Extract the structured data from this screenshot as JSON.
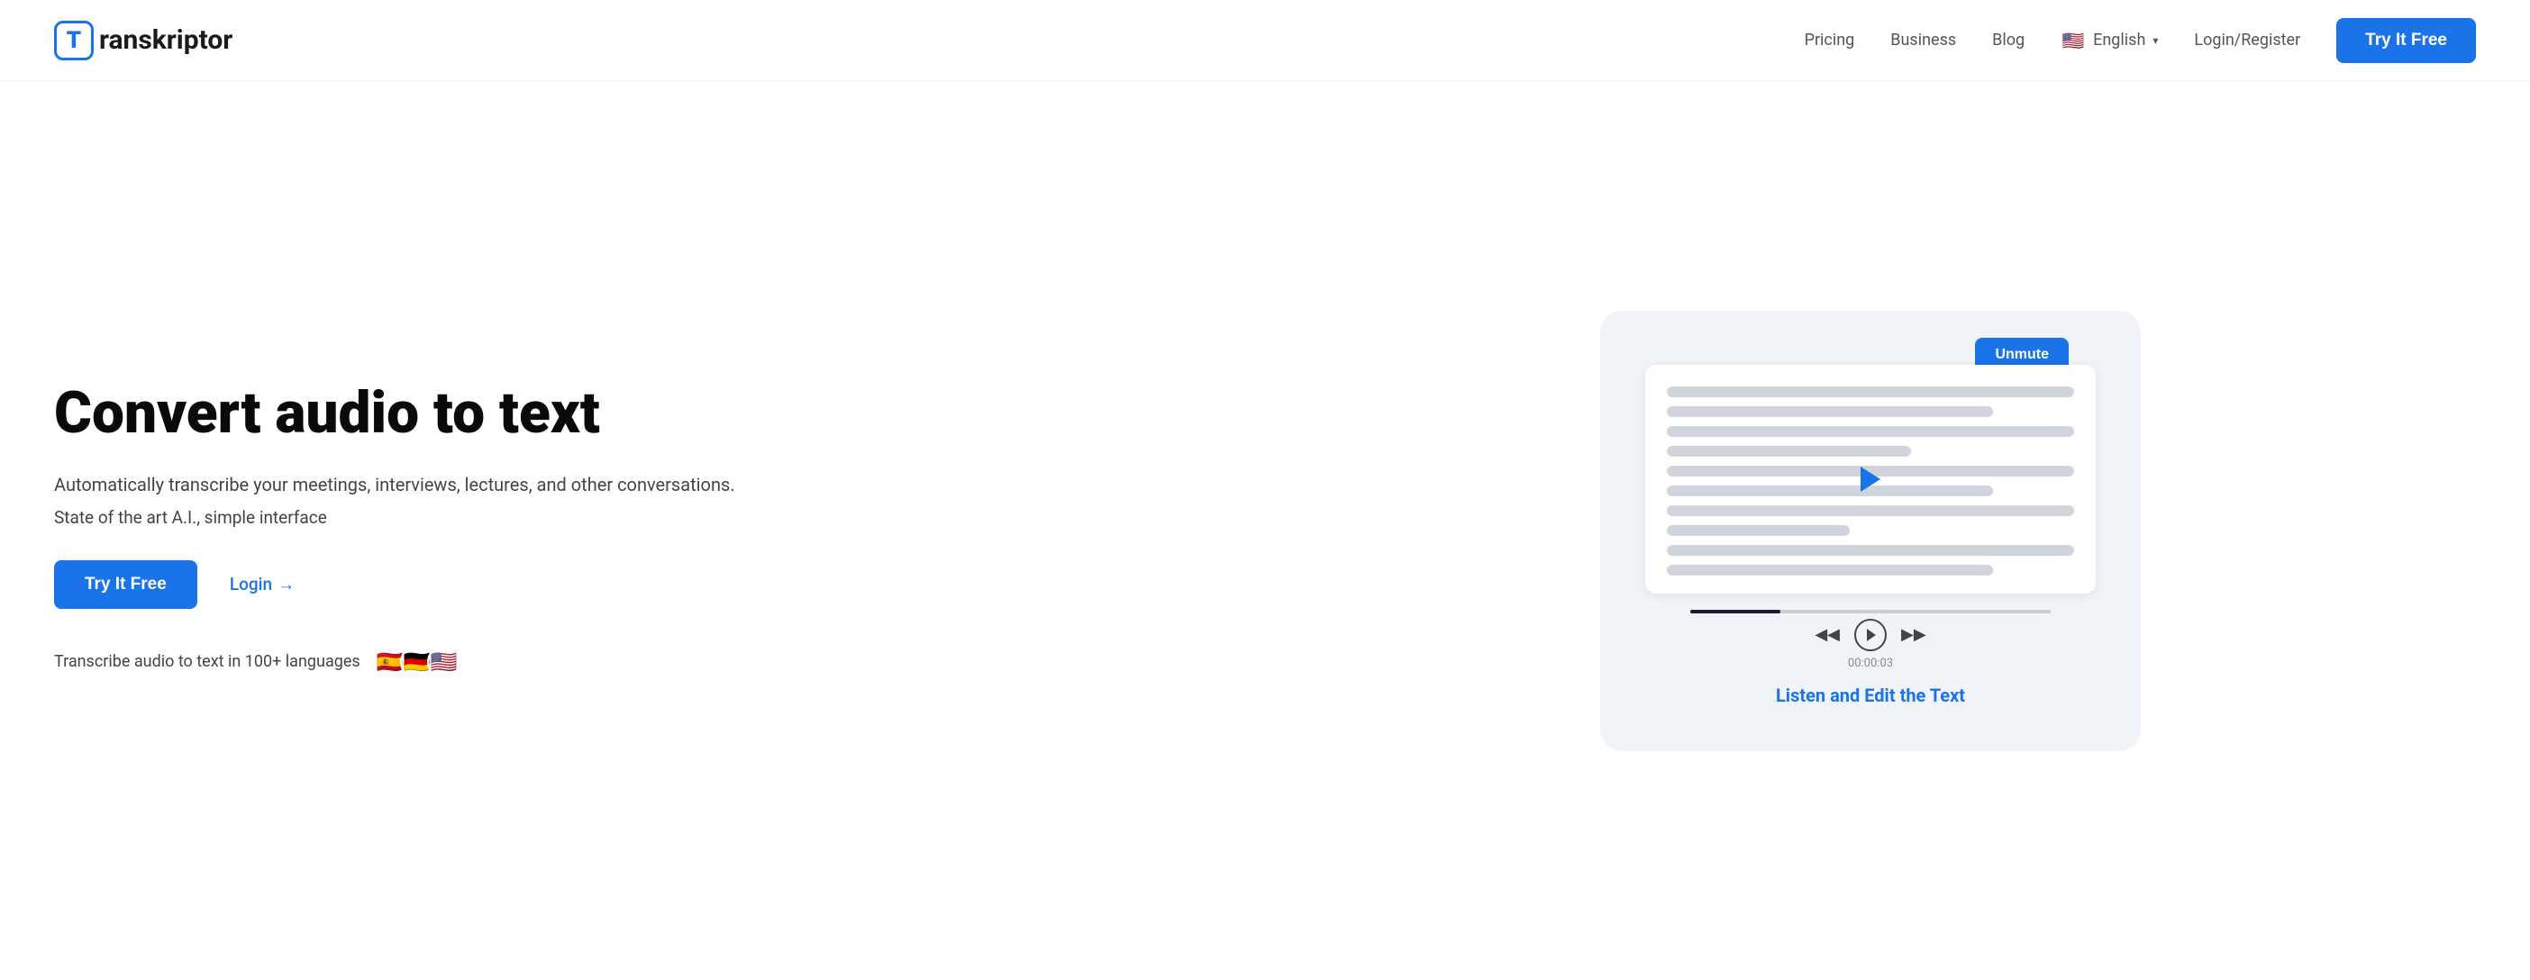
{
  "navbar": {
    "logo_t": "T",
    "logo_name": "ranskriptor",
    "nav_links": [
      {
        "label": "Pricing",
        "id": "pricing"
      },
      {
        "label": "Business",
        "id": "business"
      },
      {
        "label": "Blog",
        "id": "blog"
      }
    ],
    "lang_flag": "🇺🇸",
    "lang_label": "English",
    "login_label": "Login/Register",
    "try_btn": "Try It Free"
  },
  "hero": {
    "title": "Convert audio to text",
    "subtitle": "Automatically transcribe your meetings, interviews, lectures, and other conversations.",
    "tagline": "State of the art A.I., simple interface",
    "try_btn": "Try It Free",
    "login_btn": "Login",
    "login_arrow": "→",
    "languages_label": "Transcribe audio to text in 100+ languages",
    "flags": [
      "🇪🇸",
      "🇩🇪",
      "🇺🇸"
    ],
    "unmute_btn": "Unmute",
    "time_label": "00:00:03",
    "listen_edit_label": "Listen and Edit the Text"
  }
}
